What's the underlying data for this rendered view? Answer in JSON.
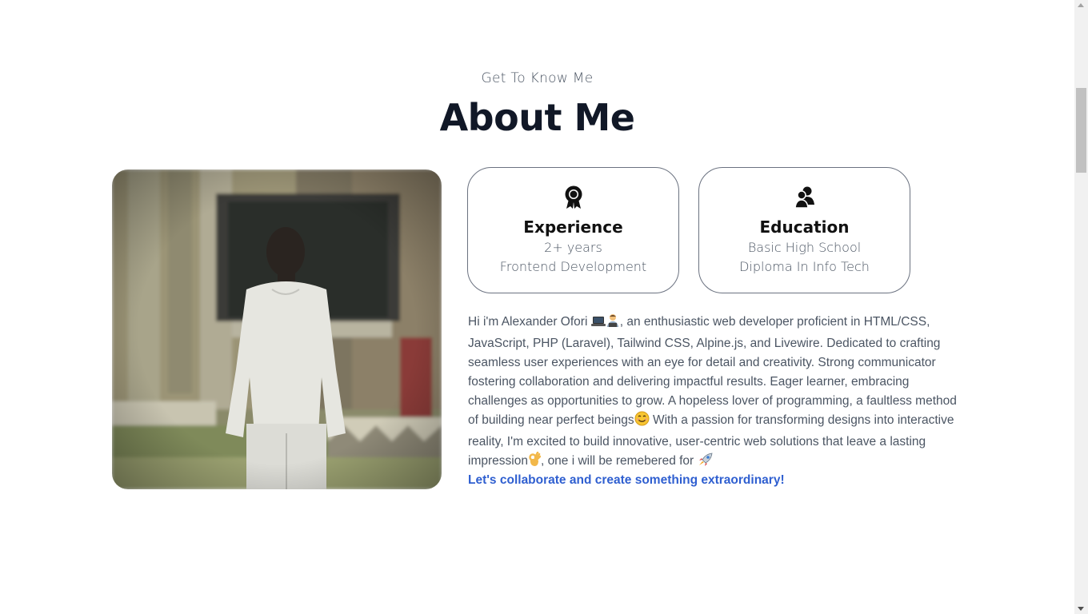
{
  "section": {
    "subtitle": "Get To Know Me",
    "title": "About Me"
  },
  "cards": [
    {
      "icon": "award-icon",
      "title": "Experience",
      "line1": "2+ years",
      "line2": "Frontend Development"
    },
    {
      "icon": "users-icon",
      "title": "Education",
      "line1": "Basic High School",
      "line2": "Diploma In Info Tech"
    }
  ],
  "bio": {
    "p1": "Hi i'm Alexander Ofori",
    "p2": ", an enthusiastic web developer proficient in HTML/CSS, JavaScript, PHP (Laravel), Tailwind CSS, Alpine.js, and Livewire. Dedicated to crafting seamless user experiences with an eye for detail and creativity. Strong communicator fostering collaboration and delivering impactful results. Eager learner, embracing challenges as opportunities to grow. A hopeless lover of programming, a faultless method of building near perfect beings",
    "p3": " With a passion for transforming designs into interactive reality, I'm excited to build innovative, user-centric web solutions that leave a lasting impression",
    "p4": ", one i will be remebered for ",
    "cta": "Let's collaborate and create something extraordinary!"
  },
  "colors": {
    "accent": "#2f5fd0",
    "heading": "#111827",
    "body_text": "#4b5563",
    "card_border": "#6b7280"
  }
}
